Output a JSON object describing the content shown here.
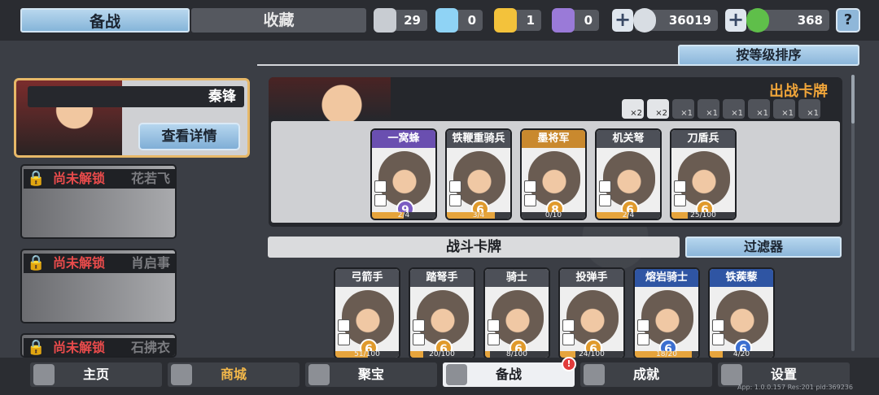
{
  "tabs": {
    "active": "备战",
    "inactive": "收藏"
  },
  "resources": [
    {
      "icon": "silver-crest-icon",
      "value": "29",
      "color": "#c8ccd2"
    },
    {
      "icon": "blue-crest-icon",
      "value": "0",
      "color": "#8fd3f5"
    },
    {
      "icon": "gold-crest-icon",
      "value": "1",
      "color": "#f3c23b"
    },
    {
      "icon": "purple-crest-icon",
      "value": "0",
      "color": "#9a7ad8"
    }
  ],
  "currency": {
    "coins": "36019",
    "gems": "368",
    "plus": "+"
  },
  "help": "?",
  "hero": {
    "name": "秦锋",
    "detail_button": "查看详情"
  },
  "locked_heroes": [
    {
      "status": "尚未解锁",
      "name": "花若飞"
    },
    {
      "status": "尚未解锁",
      "name": "肖启事"
    },
    {
      "status": "尚未解锁",
      "name": "石拂衣"
    }
  ],
  "sort_button": "按等级排序",
  "deck": {
    "title": "出战卡牌",
    "slots": [
      {
        "label": "×2",
        "on": true
      },
      {
        "label": "×2",
        "on": true
      },
      {
        "label": "×1",
        "on": false
      },
      {
        "label": "×1",
        "on": false
      },
      {
        "label": "×1",
        "on": false
      },
      {
        "label": "×1",
        "on": false
      },
      {
        "label": "×1",
        "on": false
      },
      {
        "label": "×1",
        "on": false
      }
    ],
    "cards": [
      {
        "name": "一窝蜂",
        "level": "9",
        "progress": "2/4",
        "fill": 0.5,
        "title_color": "#6a4fb0",
        "level_color": "#7b5cc2"
      },
      {
        "name": "铁鞭重骑兵",
        "level": "6",
        "progress": "3/4",
        "fill": 0.75,
        "title_color": "#4d5058",
        "level_color": "#e09a2c"
      },
      {
        "name": "墨将军",
        "level": "8",
        "progress": "0/10",
        "fill": 0.0,
        "title_color": "#c9892e",
        "level_color": "#e09a2c"
      },
      {
        "name": "机关弩",
        "level": "6",
        "progress": "2/4",
        "fill": 0.5,
        "title_color": "#4d5058",
        "level_color": "#e09a2c"
      },
      {
        "name": "刀盾兵",
        "level": "6",
        "progress": "25/100",
        "fill": 0.25,
        "title_color": "#4d5058",
        "level_color": "#e09a2c"
      }
    ]
  },
  "battle_section": {
    "title": "战斗卡牌",
    "filter": "过滤器"
  },
  "battle_cards": [
    {
      "name": "弓箭手",
      "level": "6",
      "progress": "51/100",
      "fill": 0.51,
      "title_color": "#4d5058",
      "level_color": "#e09a2c"
    },
    {
      "name": "踏弩手",
      "level": "6",
      "progress": "20/100",
      "fill": 0.2,
      "title_color": "#4d5058",
      "level_color": "#e09a2c"
    },
    {
      "name": "骑士",
      "level": "6",
      "progress": "8/100",
      "fill": 0.08,
      "title_color": "#4d5058",
      "level_color": "#e09a2c"
    },
    {
      "name": "投弹手",
      "level": "6",
      "progress": "24/100",
      "fill": 0.24,
      "title_color": "#4d5058",
      "level_color": "#e09a2c"
    },
    {
      "name": "熔岩骑士",
      "level": "6",
      "progress": "18/20",
      "fill": 0.9,
      "title_color": "#2f55a3",
      "level_color": "#3c6fd0"
    },
    {
      "name": "铁蒺藜",
      "level": "6",
      "progress": "4/20",
      "fill": 0.2,
      "title_color": "#2f55a3",
      "level_color": "#3c6fd0"
    }
  ],
  "nav": [
    {
      "label": "主页",
      "icon": "home-icon"
    },
    {
      "label": "商城",
      "icon": "coins-icon",
      "gold": true
    },
    {
      "label": "聚宝",
      "icon": "treasure-icon"
    },
    {
      "label": "备战",
      "icon": "cards-icon",
      "active": true
    },
    {
      "label": "成就",
      "icon": "achievement-icon"
    },
    {
      "label": "设置",
      "icon": "gear-icon"
    }
  ],
  "badge": "!",
  "version": "App: 1.0.0.157 Res:201 pid:369236"
}
